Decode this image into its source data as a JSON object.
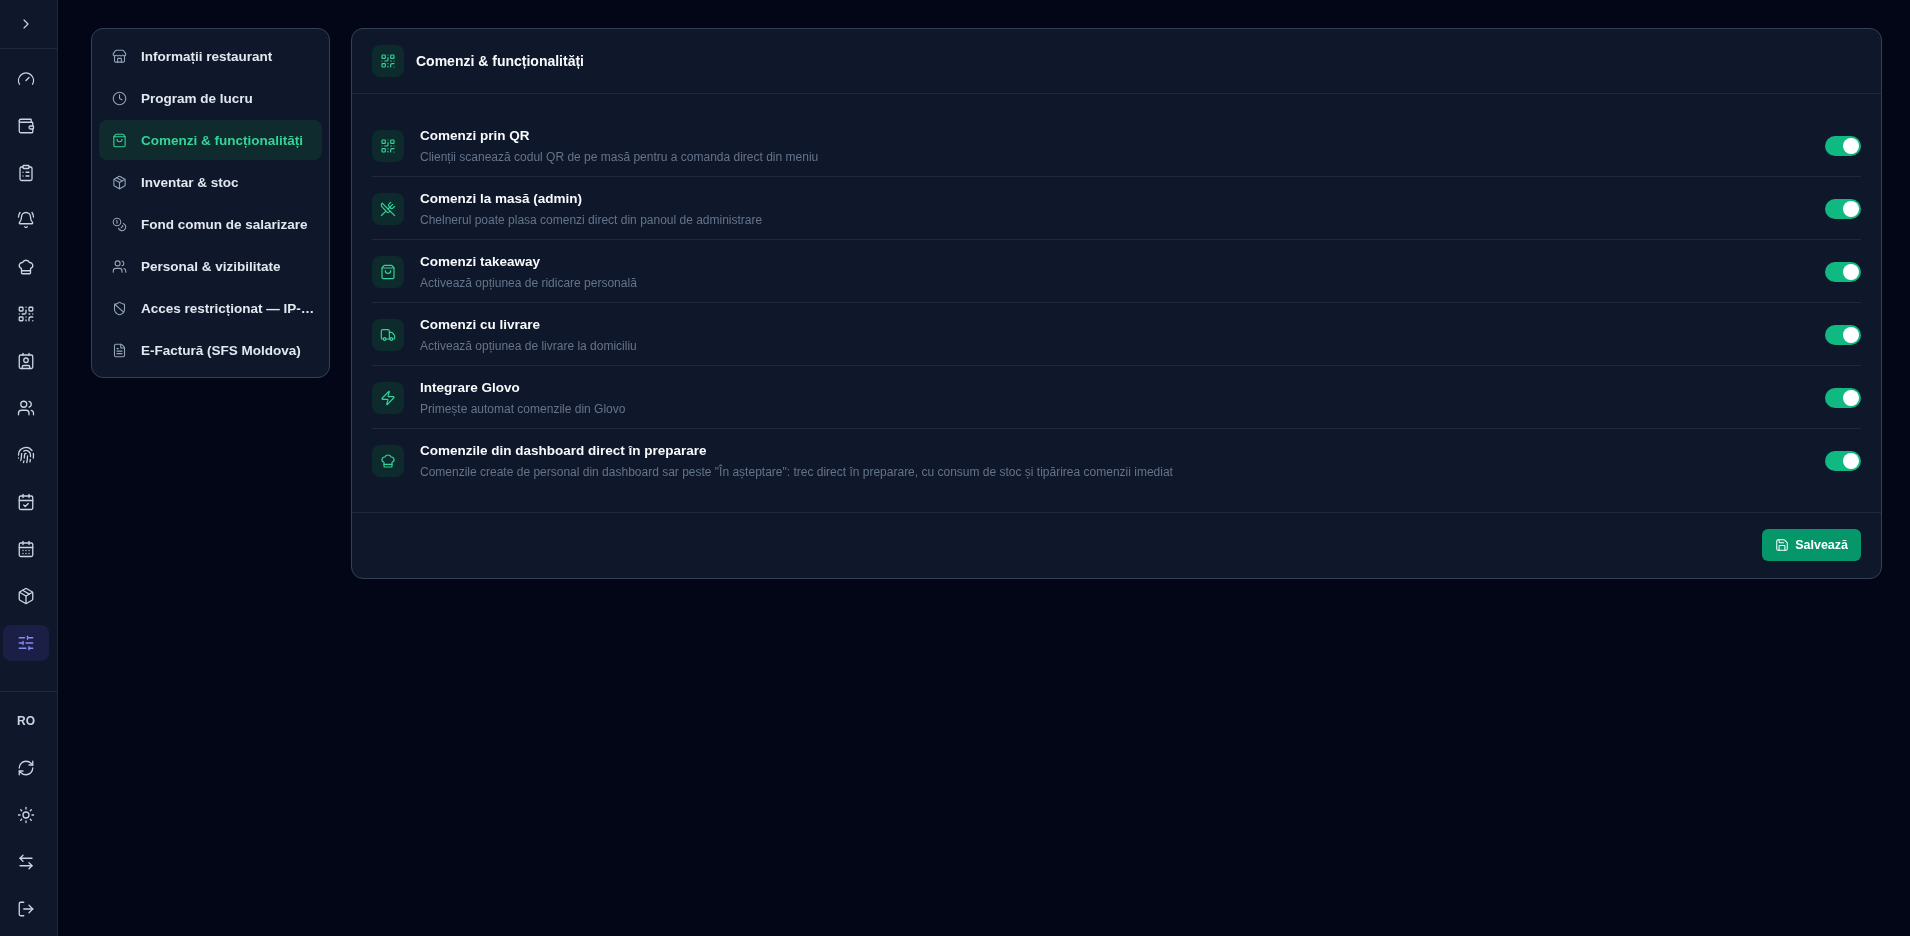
{
  "rail": {
    "items": [
      {
        "selected": false
      },
      {
        "selected": false
      },
      {
        "selected": false
      },
      {
        "selected": false
      },
      {
        "selected": false
      },
      {
        "selected": false
      },
      {
        "selected": false
      },
      {
        "selected": false
      },
      {
        "selected": false
      },
      {
        "selected": false
      },
      {
        "selected": false
      },
      {
        "selected": false
      },
      {
        "selected": true
      }
    ],
    "language": "RO"
  },
  "settings_menu": [
    {
      "label": "Informații restaurant",
      "selected": false
    },
    {
      "label": "Program de lucru",
      "selected": false
    },
    {
      "label": "Comenzi & funcționalități",
      "selected": true
    },
    {
      "label": "Inventar & stoc",
      "selected": false
    },
    {
      "label": "Fond comun de salarizare",
      "selected": false
    },
    {
      "label": "Personal & vizibilitate",
      "selected": false
    },
    {
      "label": "Acces restricționat — IP-…",
      "selected": false
    },
    {
      "label": "E-Factură (SFS Moldova)",
      "selected": false
    }
  ],
  "panel": {
    "title": "Comenzi & funcționalități",
    "rows": [
      {
        "title": "Comenzi prin QR",
        "description": "Clienții scanează codul QR de pe masă pentru a comanda direct din meniu",
        "on": true
      },
      {
        "title": "Comenzi la masă (admin)",
        "description": "Chelnerul poate plasa comenzi direct din panoul de administrare",
        "on": true
      },
      {
        "title": "Comenzi takeaway",
        "description": "Activează opțiunea de ridicare personală",
        "on": true
      },
      {
        "title": "Comenzi cu livrare",
        "description": "Activează opțiunea de livrare la domiciliu",
        "on": true
      },
      {
        "title": "Integrare Glovo",
        "description": "Primește automat comenzile din Glovo",
        "on": true
      },
      {
        "title": "Comenzile din dashboard direct în preparare",
        "description": "Comenzile create de personal din dashboard sar peste \"În așteptare\": trec direct în preparare, cu consum de stoc și tipărirea comenzii imediat",
        "on": true
      }
    ],
    "save_button": "Salvează"
  }
}
